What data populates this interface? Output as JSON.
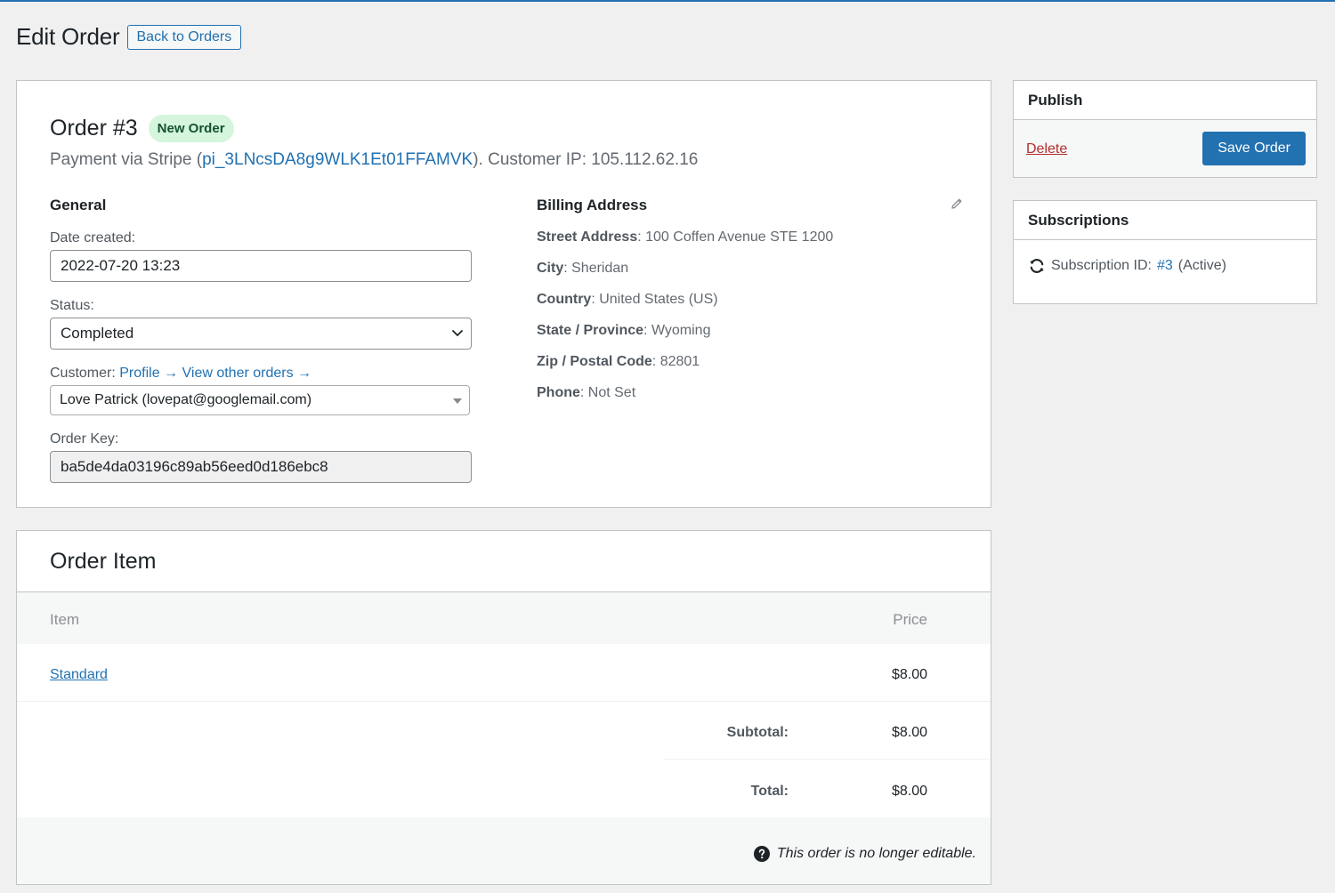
{
  "header": {
    "title": "Edit Order",
    "back_label": "Back to Orders"
  },
  "order": {
    "title": "Order #3",
    "badge": "New Order",
    "payment_prefix": "Payment via Stripe (",
    "payment_id": "pi_3LNcsDA8g9WLK1Et01FFAMVK",
    "payment_suffix": "). Customer IP: 105.112.62.16",
    "general": {
      "heading": "General",
      "date_label": "Date created:",
      "date_value": "2022-07-20 13:23",
      "status_label": "Status:",
      "status_value": "Completed",
      "customer_label": "Customer:",
      "profile_link": "Profile →",
      "other_orders_link": "View other orders →",
      "customer_value": "Love Patrick (lovepat@googlemail.com)",
      "key_label": "Order Key:",
      "key_value": "ba5de4da03196c89ab56eed0d186ebc8"
    },
    "billing": {
      "heading": "Billing Address",
      "rows": [
        {
          "label": "Street Address",
          "value": ": 100 Coffen Avenue STE 1200"
        },
        {
          "label": "City",
          "value": ": Sheridan"
        },
        {
          "label": "Country",
          "value": ": United States (US)"
        },
        {
          "label": "State / Province",
          "value": ": Wyoming"
        },
        {
          "label": "Zip / Postal Code",
          "value": ": 82801"
        },
        {
          "label": "Phone",
          "value": ": Not Set"
        }
      ]
    }
  },
  "items": {
    "title": "Order Item",
    "col_item": "Item",
    "col_price": "Price",
    "rows": [
      {
        "name": "Standard",
        "price": "$8.00"
      }
    ],
    "subtotal_label": "Subtotal:",
    "subtotal_value": "$8.00",
    "total_label": "Total:",
    "total_value": "$8.00",
    "footer_note": "This order is no longer editable."
  },
  "publish": {
    "heading": "Publish",
    "delete_label": "Delete",
    "save_label": "Save Order"
  },
  "subscriptions": {
    "heading": "Subscriptions",
    "prefix": "Subscription ID:",
    "id_link": "#3",
    "status": "(Active)"
  },
  "icons": {
    "chevron": "chevron-down-icon",
    "edit": "pencil-icon",
    "help": "help-icon",
    "sync": "sync-icon"
  },
  "colors": {
    "accent": "#2271b1",
    "danger": "#b32d2e",
    "badge_bg": "#d5f5dd",
    "badge_text": "#14532d"
  }
}
